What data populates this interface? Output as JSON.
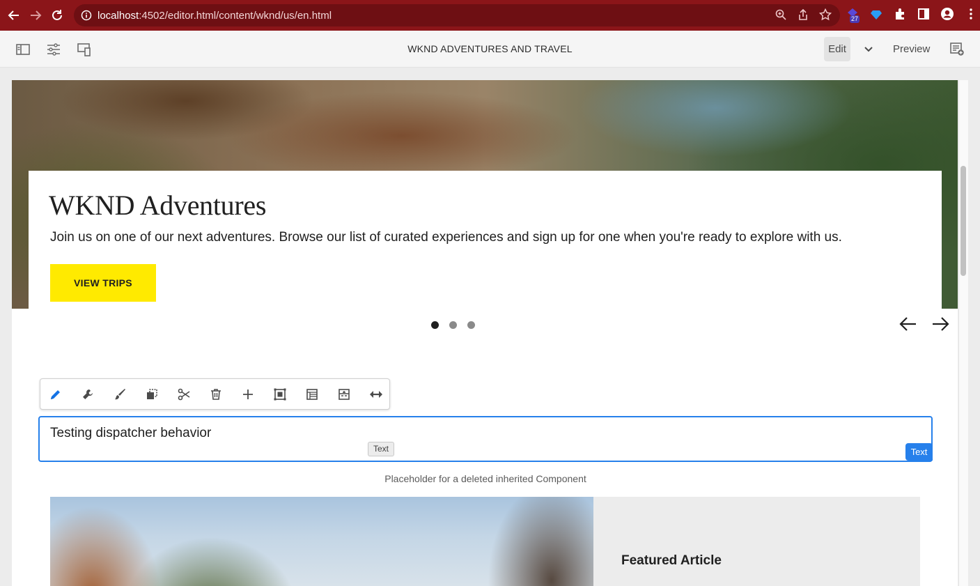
{
  "browser": {
    "url_host": "localhost",
    "url_path": ":4502/editor.html/content/wknd/us/en.html",
    "extension_badge": "27"
  },
  "editor": {
    "page_title": "WKND ADVENTURES AND TRAVEL",
    "edit_label": "Edit",
    "preview_label": "Preview"
  },
  "hero": {
    "title": "WKND Adventures",
    "description": "Join us on one of our next adventures. Browse our list of curated experiences and sign up for one when you're ready to explore with us.",
    "button_label": "VIEW TRIPS",
    "slides_total": 3,
    "active_slide": 1
  },
  "component_toolbar": {
    "actions": [
      "edit",
      "configure",
      "styles",
      "copy",
      "cut",
      "delete",
      "insert",
      "group",
      "parent",
      "layout",
      "resize"
    ]
  },
  "text_component": {
    "content": "Testing dispatcher behavior",
    "hover_label": "Text",
    "badge_label": "Text"
  },
  "placeholder": {
    "text": "Placeholder for a deleted inherited Component"
  },
  "featured": {
    "title": "Featured Article"
  },
  "colors": {
    "browser_bar": "#8b1519",
    "accent": "#2680eb",
    "hero_button": "#ffea00"
  }
}
